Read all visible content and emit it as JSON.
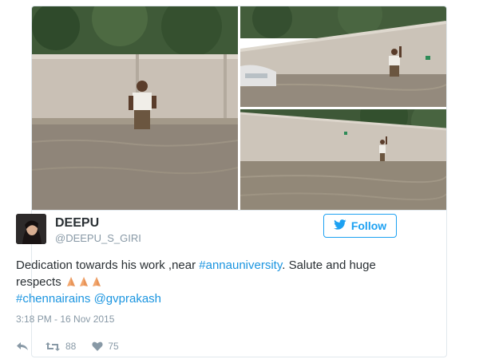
{
  "tweet": {
    "display_name": "DEEPU",
    "handle": "@DEEPU_S_GIRI",
    "follow_label": "Follow",
    "text_part1": "Dedication towards his work ,near ",
    "hashtag_1": "#annauniversity",
    "text_part2": ". Salute and huge respects ",
    "hashtag_2": "#chennairains",
    "mention": "@gvprakash",
    "timestamp": "3:18 PM - 16 Nov 2015",
    "retweet_count": "88",
    "like_count": "75"
  },
  "colors": {
    "accent": "#1da1f2",
    "link": "#1b95e0",
    "text": "#292f33",
    "muted": "#8899a6"
  },
  "icons": {
    "follow": "bird-icon",
    "reply": "reply-icon",
    "retweet": "retweet-icon",
    "like": "heart-icon",
    "emoji": "folded-hands-emoji"
  }
}
